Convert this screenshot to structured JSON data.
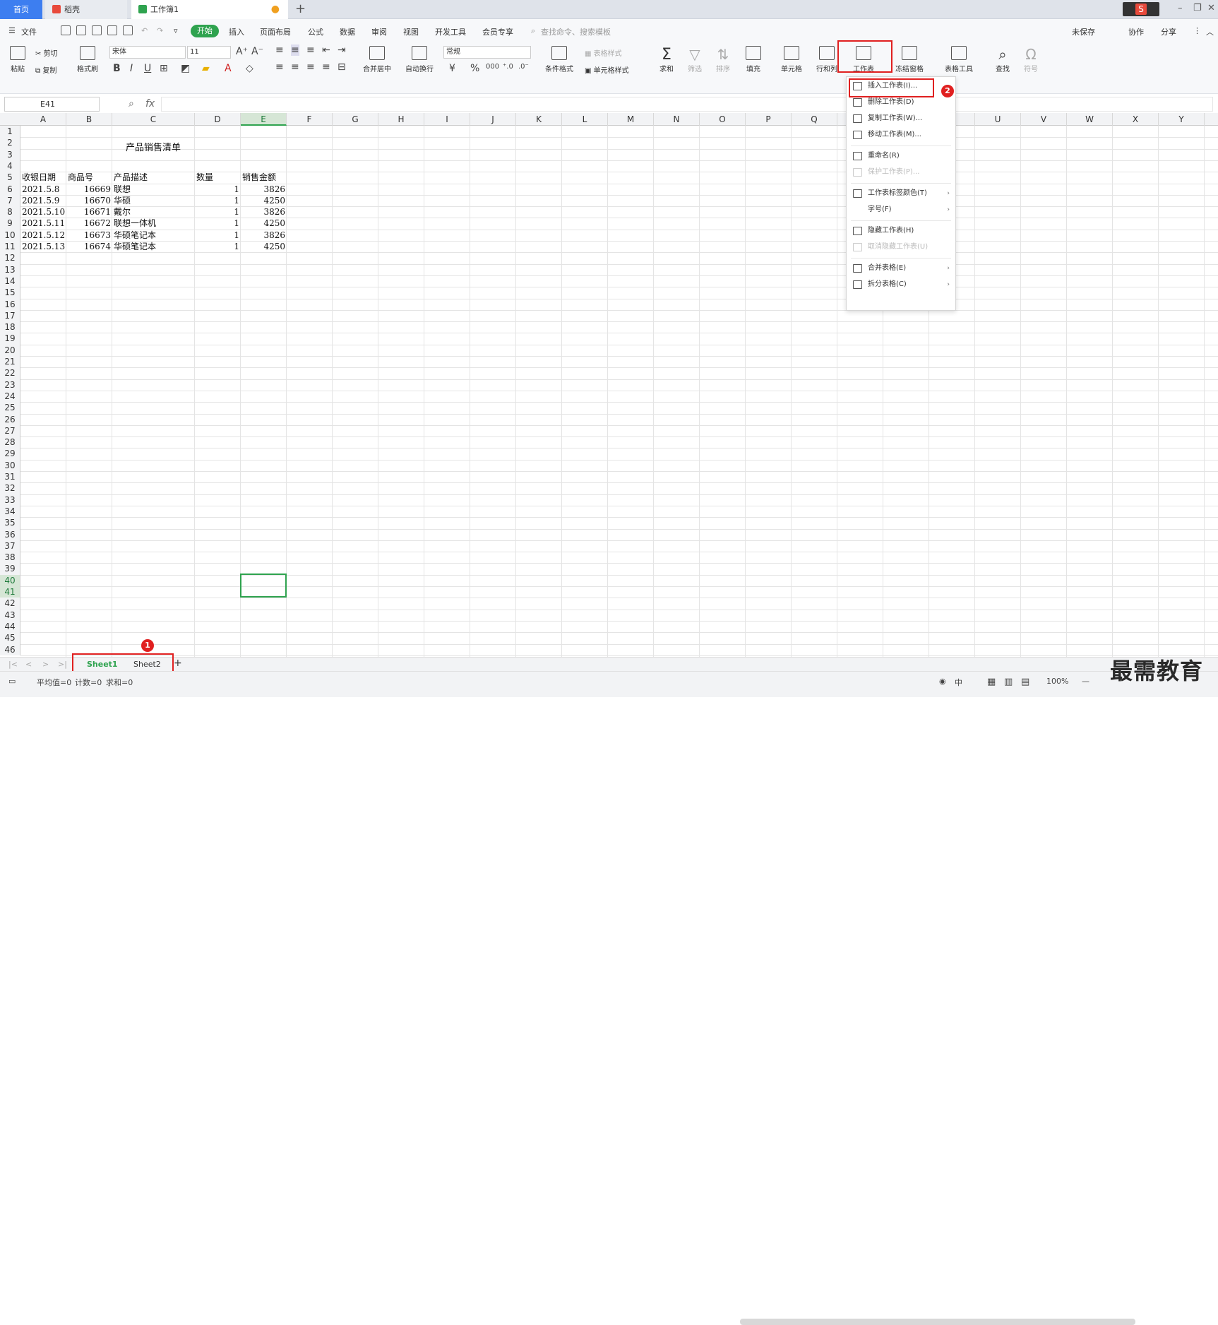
{
  "tabs": {
    "home": "首页",
    "daoke": "稻壳",
    "workbook": "工作簿1"
  },
  "menus": [
    "文件",
    "开始",
    "插入",
    "页面布局",
    "公式",
    "数据",
    "审阅",
    "视图",
    "开发工具",
    "会员专享"
  ],
  "search_placeholder": "查找命令、搜索模板",
  "right_actions": [
    "未保存",
    "协作",
    "分享"
  ],
  "ribbon": {
    "paste": "粘贴",
    "cut": "剪切",
    "copy": "复制",
    "format_painter": "格式刷",
    "font_name": "宋体",
    "font_size": "11",
    "merge": "合并居中",
    "wrap": "自动换行",
    "number_format": "常规",
    "cond_format": "条件格式",
    "table_style": "表格样式",
    "cell_style": "单元格样式",
    "sum": "求和",
    "filter": "筛选",
    "sort": "排序",
    "fill": "填充",
    "cell": "单元格",
    "rowcol": "行和列",
    "worksheet": "工作表",
    "freeze": "冻结窗格",
    "table_tools": "表格工具",
    "find": "查找",
    "symbol": "符号"
  },
  "formula": {
    "name_box": "E41",
    "fx": "fx"
  },
  "columns": [
    "A",
    "B",
    "C",
    "D",
    "E",
    "F",
    "G",
    "H",
    "I",
    "J",
    "K",
    "L",
    "M",
    "N",
    "O",
    "P",
    "Q",
    "R",
    "S",
    "T",
    "U",
    "V",
    "W",
    "X",
    "Y"
  ],
  "title": "产品销售清单",
  "headers": [
    "收银日期",
    "商品号",
    "产品描述",
    "数量",
    "销售金额"
  ],
  "rows": [
    [
      "2021.5.8",
      "16669",
      "联想",
      "1",
      "3826"
    ],
    [
      "2021.5.9",
      "16670",
      "华硕",
      "1",
      "4250"
    ],
    [
      "2021.5.10",
      "16671",
      "戴尔",
      "1",
      "3826"
    ],
    [
      "2021.5.11",
      "16672",
      "联想一体机",
      "1",
      "4250"
    ],
    [
      "2021.5.12",
      "16673",
      "华硕笔记本",
      "1",
      "3826"
    ],
    [
      "2021.5.13",
      "16674",
      "华硕笔记本",
      "1",
      "4250"
    ]
  ],
  "context_menu": [
    {
      "label": "插入工作表(I)...",
      "disabled": false,
      "submenu": false
    },
    {
      "label": "删除工作表(D)",
      "disabled": false,
      "submenu": false
    },
    {
      "label": "复制工作表(W)...",
      "disabled": false,
      "submenu": false
    },
    {
      "label": "移动工作表(M)...",
      "disabled": false,
      "submenu": false
    },
    {
      "label": "重命名(R)",
      "disabled": false,
      "submenu": false
    },
    {
      "label": "保护工作表(P)...",
      "disabled": true,
      "submenu": false
    },
    {
      "label": "工作表标签颜色(T)",
      "disabled": false,
      "submenu": true
    },
    {
      "label": "字号(F)",
      "disabled": false,
      "submenu": true
    },
    {
      "label": "隐藏工作表(H)",
      "disabled": false,
      "submenu": false
    },
    {
      "label": "取消隐藏工作表(U)",
      "disabled": true,
      "submenu": false
    },
    {
      "label": "合并表格(E)",
      "disabled": false,
      "submenu": true
    },
    {
      "label": "拆分表格(C)",
      "disabled": false,
      "submenu": true
    }
  ],
  "sheets": [
    "Sheet1",
    "Sheet2"
  ],
  "status": {
    "avg": "平均值=0",
    "count": "计数=0",
    "sum": "求和=0",
    "zoom": "100%",
    "ime": "中"
  },
  "badges": [
    "1",
    "2"
  ],
  "watermark": "最需教育",
  "colors": {
    "accent": "#2fa34f",
    "highlight": "#e02020",
    "home_tab": "#3d7ef0"
  }
}
